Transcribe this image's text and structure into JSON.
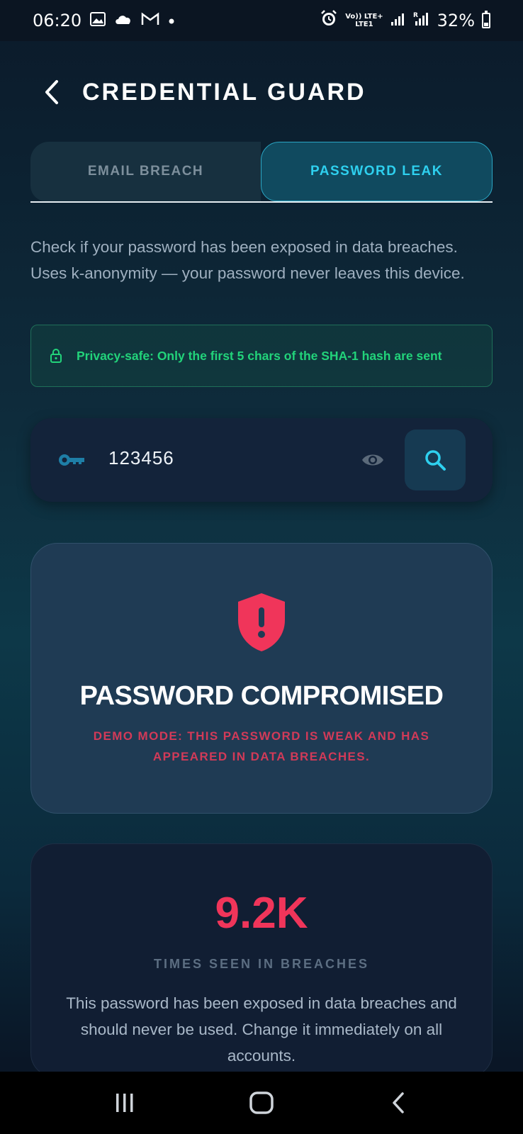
{
  "status_bar": {
    "time": "06:20",
    "notification_icons": [
      "gallery-icon",
      "cloud-icon",
      "gmail-icon",
      "dot-icon"
    ],
    "network_top": "Vo)) LTE+",
    "network_bottom": "LTE1",
    "battery": "32%"
  },
  "header": {
    "title": "CREDENTIAL GUARD"
  },
  "tabs": [
    {
      "label": "EMAIL BREACH",
      "active": false
    },
    {
      "label": "PASSWORD LEAK",
      "active": true
    }
  ],
  "description": "Check if your password has been exposed in data breaches. Uses k-anonymity — your password never leaves this device.",
  "privacy_note": "Privacy-safe: Only the first 5 chars of the SHA-1 hash are sent",
  "password_field": {
    "value": "123456"
  },
  "result": {
    "title": "PASSWORD COMPROMISED",
    "subtitle": "DEMO MODE: THIS PASSWORD IS WEAK AND HAS APPEARED IN DATA BREACHES."
  },
  "stats": {
    "value": "9.2K",
    "label": "TIMES SEEN IN BREACHES",
    "description": "This password has been exposed in data breaches and should never be used. Change it immediately on all accounts."
  },
  "colors": {
    "accent": "#2ed0ef",
    "danger": "#f0355a",
    "success": "#22d37a"
  }
}
